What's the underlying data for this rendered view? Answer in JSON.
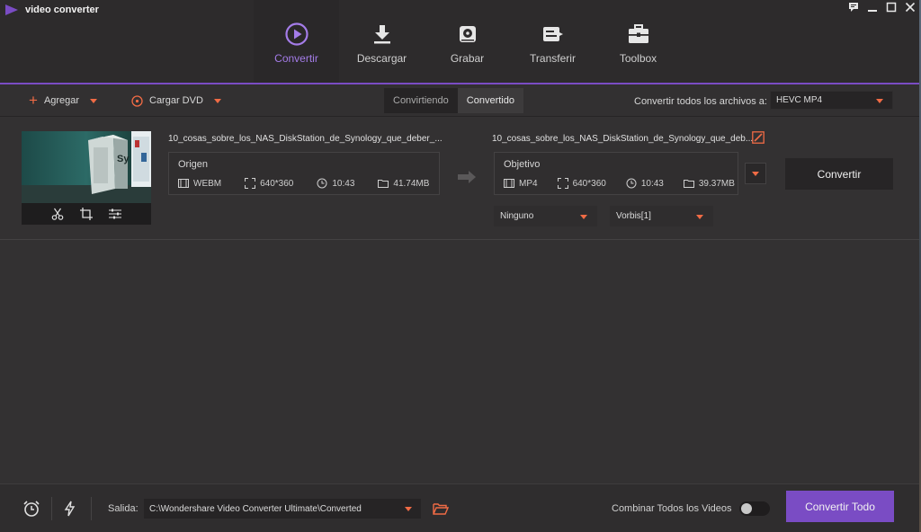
{
  "app": {
    "title": "video converter",
    "brand_color": "#7a4cc4",
    "accent_color": "#f06b45",
    "window_controls": [
      "chat-icon",
      "minimize-icon",
      "maximize-icon",
      "close-icon"
    ]
  },
  "nav": {
    "items": [
      {
        "label": "Convertir",
        "icon": "play-circle-icon",
        "active": true
      },
      {
        "label": "Descargar",
        "icon": "download-icon",
        "active": false
      },
      {
        "label": "Grabar",
        "icon": "disc-burn-icon",
        "active": false
      },
      {
        "label": "Transferir",
        "icon": "transfer-icon",
        "active": false
      },
      {
        "label": "Toolbox",
        "icon": "toolbox-icon",
        "active": false
      }
    ]
  },
  "toolbar": {
    "add_label": "Agregar",
    "load_dvd_label": "Cargar DVD",
    "tabs": [
      {
        "label": "Convirtiendo",
        "active": false
      },
      {
        "label": "Convertido",
        "active": true
      }
    ],
    "convert_all_to_label": "Convertir todos los archivos a:",
    "convert_all_to_value": "HEVC MP4"
  },
  "file": {
    "source_name": "10_cosas_sobre_los_NAS_DiskStation_de_Synology_que_deber_...",
    "target_name": "10_cosas_sobre_los_NAS_DiskStation_de_Synology_que_deb...",
    "thumb_tools": [
      "scissors-icon",
      "crop-icon",
      "sliders-icon"
    ],
    "source": {
      "title": "Origen",
      "format": "WEBM",
      "resolution": "640*360",
      "duration": "10:43",
      "size": "41.74MB"
    },
    "target": {
      "title": "Objetivo",
      "format": "MP4",
      "resolution": "640*360",
      "duration": "10:43",
      "size": "39.37MB"
    },
    "subtitle_value": "Ninguno",
    "audio_value": "Vorbis[1]",
    "convert_label": "Convertir"
  },
  "bottom": {
    "output_label": "Salida:",
    "output_path": "C:\\Wondershare Video Converter Ultimate\\Converted",
    "combine_label": "Combinar Todos los Videos",
    "combine_on": false,
    "convert_all_label": "Convertir Todo"
  }
}
